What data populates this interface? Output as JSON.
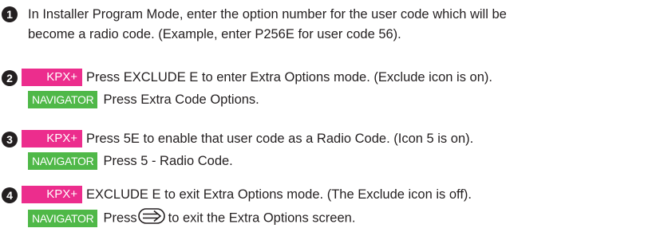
{
  "steps": [
    {
      "number": "1",
      "lines": [
        "In Installer Program Mode, enter the option number for the user code which will be",
        "become a radio code. (Example, enter P256E for user code 56)."
      ]
    },
    {
      "number": "2",
      "kpx_label": "KPX+",
      "kpx_text": "Press EXCLUDE E to enter Extra Options mode. (Exclude icon is on).",
      "nav_label": "NAVIGATOR",
      "nav_text": "Press Extra Code Options."
    },
    {
      "number": "3",
      "kpx_label": "KPX+",
      "kpx_text": "Press 5E to enable that user code as a Radio Code. (Icon 5 is on).",
      "nav_label": "NAVIGATOR",
      "nav_text": "Press 5 - Radio Code."
    },
    {
      "number": "4",
      "kpx_label": "KPX+",
      "kpx_text": "EXCLUDE E to exit Extra Options mode. (The Exclude icon is off).",
      "nav_label": "NAVIGATOR",
      "nav_text_before": "Press",
      "nav_icon": "right-arrow-key-icon",
      "nav_text_after": "to exit the Extra Options screen."
    }
  ],
  "colors": {
    "kpx": "#ec2d8d",
    "navigator": "#4fb848",
    "text": "#231f20"
  }
}
